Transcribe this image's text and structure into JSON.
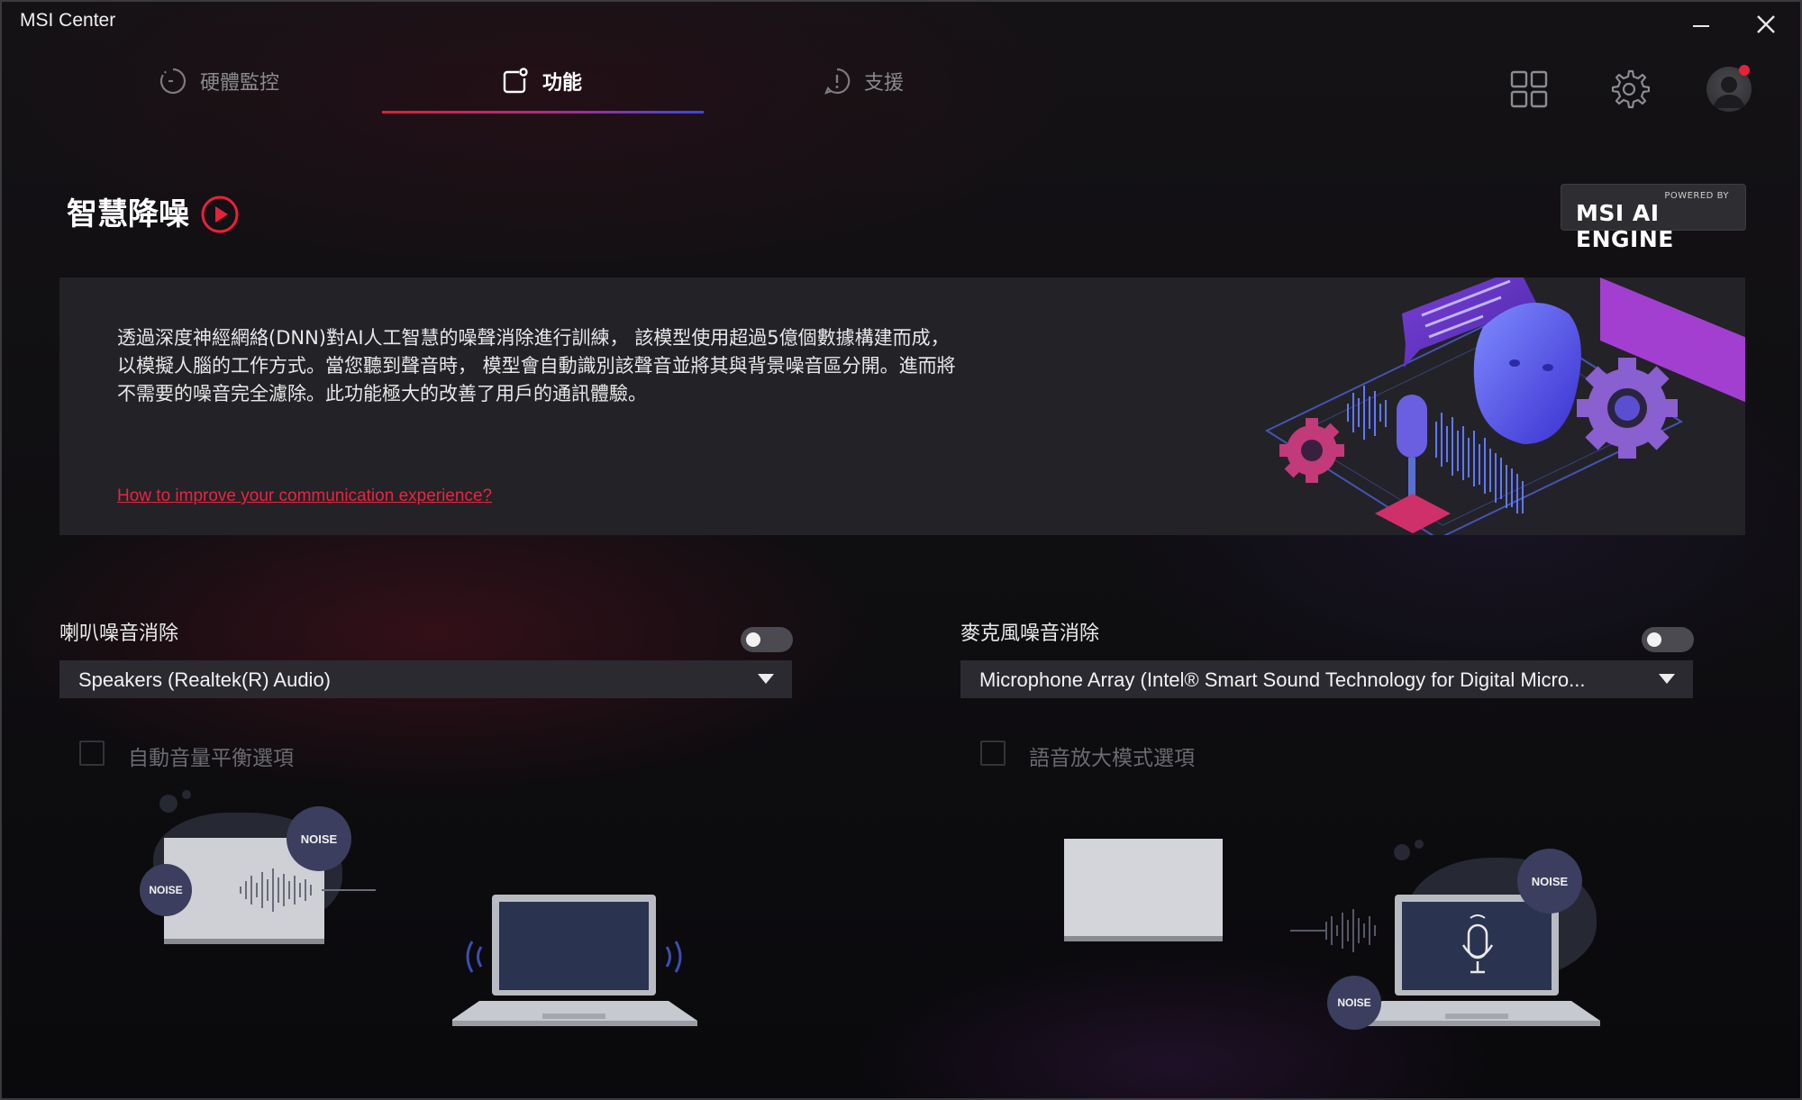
{
  "window": {
    "title": "MSI Center"
  },
  "tabs": [
    {
      "label": "硬體監控"
    },
    {
      "label": "功能"
    },
    {
      "label": "支援"
    }
  ],
  "header": {
    "title": "智慧降噪",
    "badge_small": "POWERED BY",
    "badge_big": "MSI AI ENGINE"
  },
  "info": {
    "description": "透過深度神經網絡(DNN)對AI人工智慧的噪聲消除進行訓練， 該模型使用超過5億個數據構建而成， 以模擬人腦的工作方式。當您聽到聲音時， 模型會自動識別該聲音並將其與背景噪音區分開。進而將不需要的噪音完全濾除。此功能極大的改善了用戶的通訊體驗。",
    "link": "How to improve your communication experience?"
  },
  "speaker": {
    "label": "喇叭噪音消除",
    "toggle_on": false,
    "device": "Speakers (Realtek(R) Audio)",
    "option_label": "自動音量平衡選項",
    "option_checked": false
  },
  "microphone": {
    "label": "麥克風噪音消除",
    "toggle_on": false,
    "device": "Microphone Array (Intel® Smart Sound Technology for Digital Micro...",
    "option_label": "語音放大模式選項",
    "option_checked": false
  },
  "illustration": {
    "noise_label": "NOISE"
  },
  "colors": {
    "accent_red": "#e8213a",
    "tab_gradient_end": "#3b46e6",
    "panel_bg": "#252429"
  }
}
